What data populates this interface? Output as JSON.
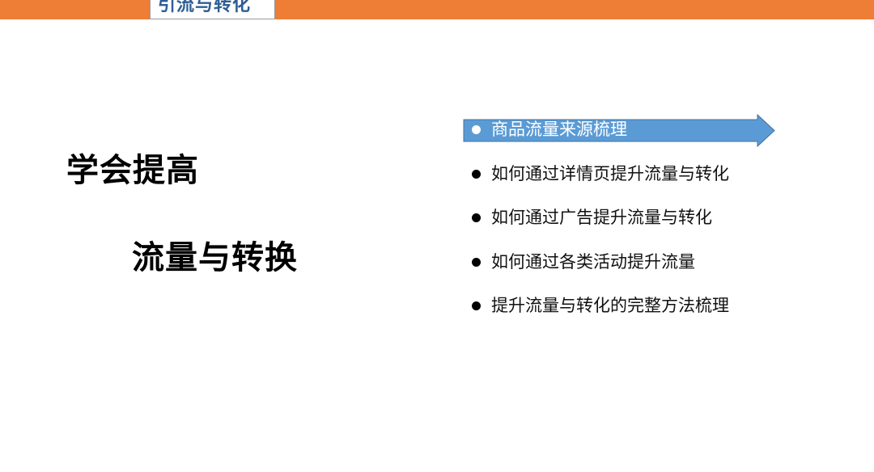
{
  "header": {
    "tab_label": "引流与转化",
    "bar_color": "#ee7d35",
    "tab_text_color": "#2e5e94"
  },
  "headline": {
    "line1": "学会提高",
    "line2": "流量与转换"
  },
  "topics": {
    "active_index": 0,
    "highlight_color": "#5b9bd5",
    "items": [
      {
        "label": "商品流量来源梳理"
      },
      {
        "label": "如何通过详情页提升流量与转化"
      },
      {
        "label": "如何通过广告提升流量与转化"
      },
      {
        "label": "如何通过各类活动提升流量"
      },
      {
        "label": "提升流量与转化的完整方法梳理"
      }
    ]
  }
}
